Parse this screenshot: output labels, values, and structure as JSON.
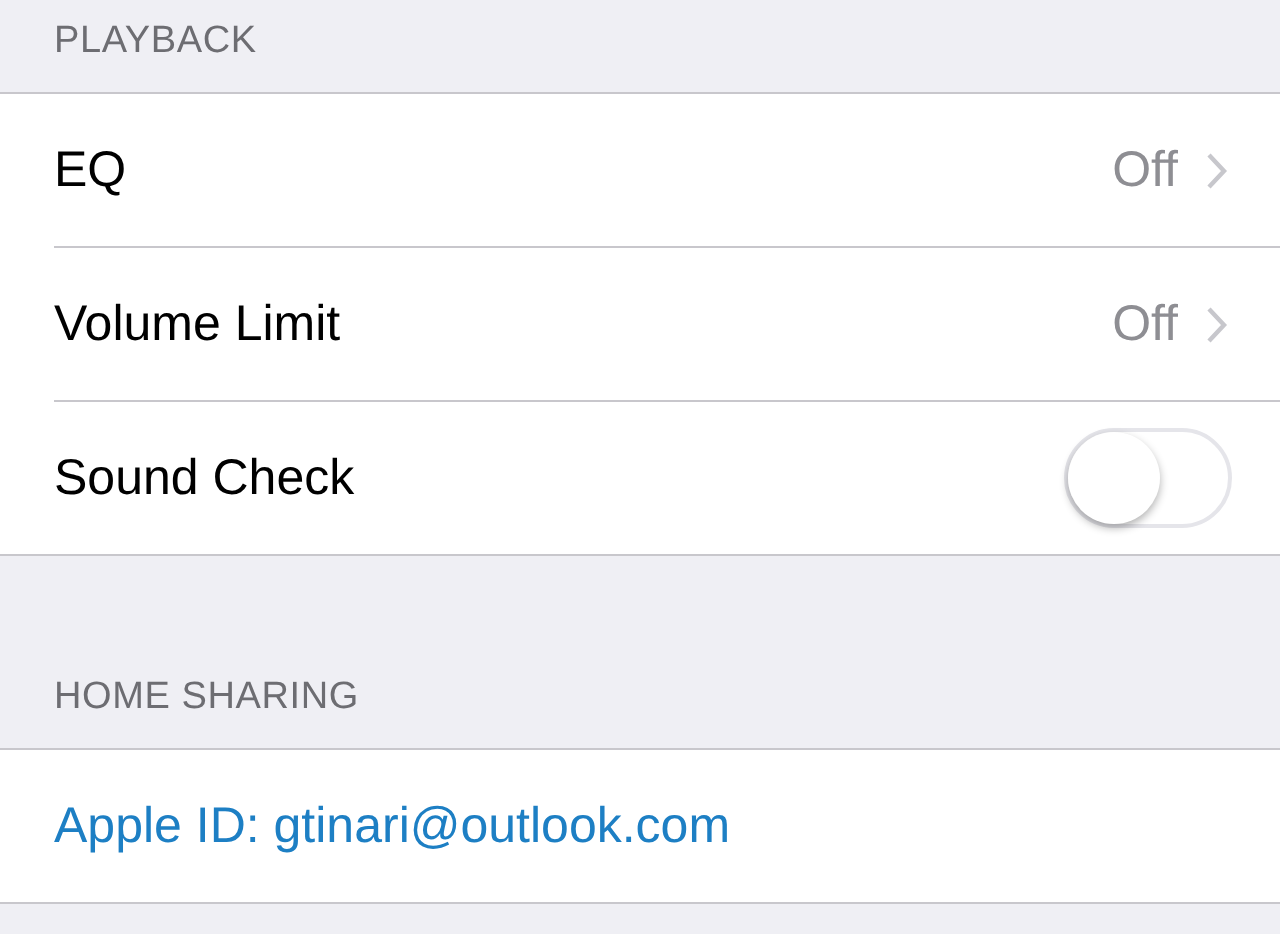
{
  "sections": [
    {
      "header": "PLAYBACK",
      "rows": [
        {
          "kind": "detail",
          "label": "EQ",
          "value": "Off"
        },
        {
          "kind": "detail",
          "label": "Volume Limit",
          "value": "Off"
        },
        {
          "kind": "toggle",
          "label": "Sound Check",
          "on": false
        }
      ]
    },
    {
      "header": "HOME SHARING",
      "rows": [
        {
          "kind": "link",
          "label": "Apple ID: gtinari@outlook.com"
        }
      ]
    }
  ]
}
